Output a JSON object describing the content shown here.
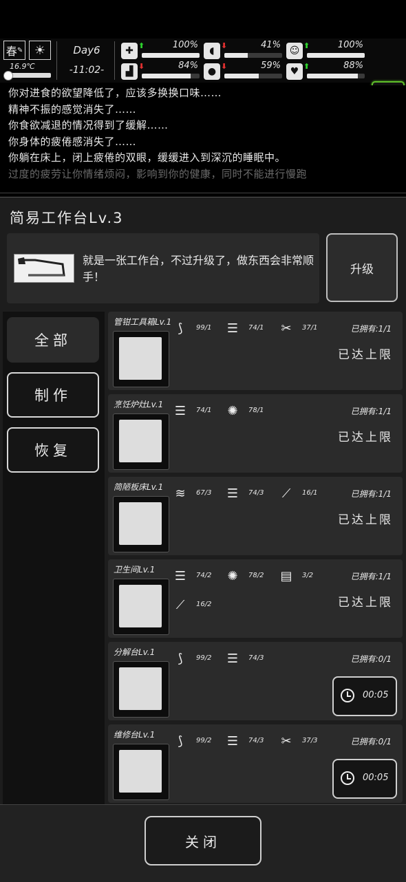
{
  "status": {
    "season": "春",
    "weather_icon": "sun-icon",
    "temperature": "16.9℃",
    "day": "Day6",
    "time": "-11:02-",
    "stats": [
      {
        "icon": "medkit-icon",
        "trend": "up",
        "value": "100%",
        "level": 1.0
      },
      {
        "icon": "stomach-icon",
        "trend": "down",
        "value": "41%",
        "level": 0.41
      },
      {
        "icon": "mood-icon",
        "trend": "up",
        "value": "100%",
        "level": 1.0
      },
      {
        "icon": "foot-icon",
        "trend": "down",
        "value": "84%",
        "level": 0.84
      },
      {
        "icon": "water-drop-icon",
        "trend": "down",
        "value": "59%",
        "level": 0.59
      },
      {
        "icon": "heart-icon",
        "trend": "up",
        "value": "88%",
        "level": 0.88
      }
    ],
    "accent_color": "#5fbf2a"
  },
  "log": [
    "你对进食的欲望降低了，应该多换换口味……",
    "精神不振的感觉消失了……",
    "你食欲减退的情况得到了缓解……",
    "你身体的疲倦感消失了……",
    "你躺在床上，闭上疲倦的双眼，缓缓进入到深沉的睡眠中。",
    "过度的疲劳让你情绪烦闷，影响到你的健康，同时不能进行慢跑"
  ],
  "panel": {
    "title": "简易工作台Lv.3",
    "description": "就是一张工作台，不过升级了，做东西会非常顺手！",
    "upgrade_label": "升级",
    "tabs": [
      "全部",
      "制作",
      "恢复"
    ],
    "close_label": "关闭"
  },
  "items": [
    {
      "name": "管钳工具箱Lv.1",
      "owned": "已拥有:1/1",
      "maxed": "已达上限",
      "timer": null,
      "materials": [
        {
          "icon": "pipe-icon",
          "qty": "99/1"
        },
        {
          "icon": "wood-logs-icon",
          "qty": "74/1"
        },
        {
          "icon": "tools-icon",
          "qty": "37/1"
        }
      ]
    },
    {
      "name": "烹饪炉灶Lv.1",
      "owned": "已拥有:1/1",
      "maxed": "已达上限",
      "timer": null,
      "materials": [
        {
          "icon": "wood-logs-icon",
          "qty": "74/1"
        },
        {
          "icon": "scrap-icon",
          "qty": "78/1"
        }
      ]
    },
    {
      "name": "简陋板床Lv.1",
      "owned": "已拥有:1/1",
      "maxed": "已达上限",
      "timer": null,
      "materials": [
        {
          "icon": "cloth-icon",
          "qty": "67/3"
        },
        {
          "icon": "wood-logs-icon",
          "qty": "74/3"
        },
        {
          "icon": "nails-icon",
          "qty": "16/1"
        }
      ]
    },
    {
      "name": "卫生间Lv.1",
      "owned": "已拥有:1/1",
      "maxed": "已达上限",
      "timer": null,
      "materials": [
        {
          "icon": "wood-logs-icon",
          "qty": "74/2"
        },
        {
          "icon": "scrap-icon",
          "qty": "78/2"
        },
        {
          "icon": "planks-icon",
          "qty": "3/2"
        },
        {
          "icon": "nails-icon",
          "qty": "16/2"
        }
      ]
    },
    {
      "name": "分解台Lv.1",
      "owned": "已拥有:0/1",
      "maxed": null,
      "timer": "00:05",
      "materials": [
        {
          "icon": "pipe-icon",
          "qty": "99/2"
        },
        {
          "icon": "wood-logs-icon",
          "qty": "74/3"
        }
      ]
    },
    {
      "name": "维修台Lv.1",
      "owned": "已拥有:0/1",
      "maxed": null,
      "timer": "00:05",
      "materials": [
        {
          "icon": "pipe-icon",
          "qty": "99/2"
        },
        {
          "icon": "wood-logs-icon",
          "qty": "74/3"
        },
        {
          "icon": "tools-icon",
          "qty": "37/3"
        }
      ]
    }
  ]
}
